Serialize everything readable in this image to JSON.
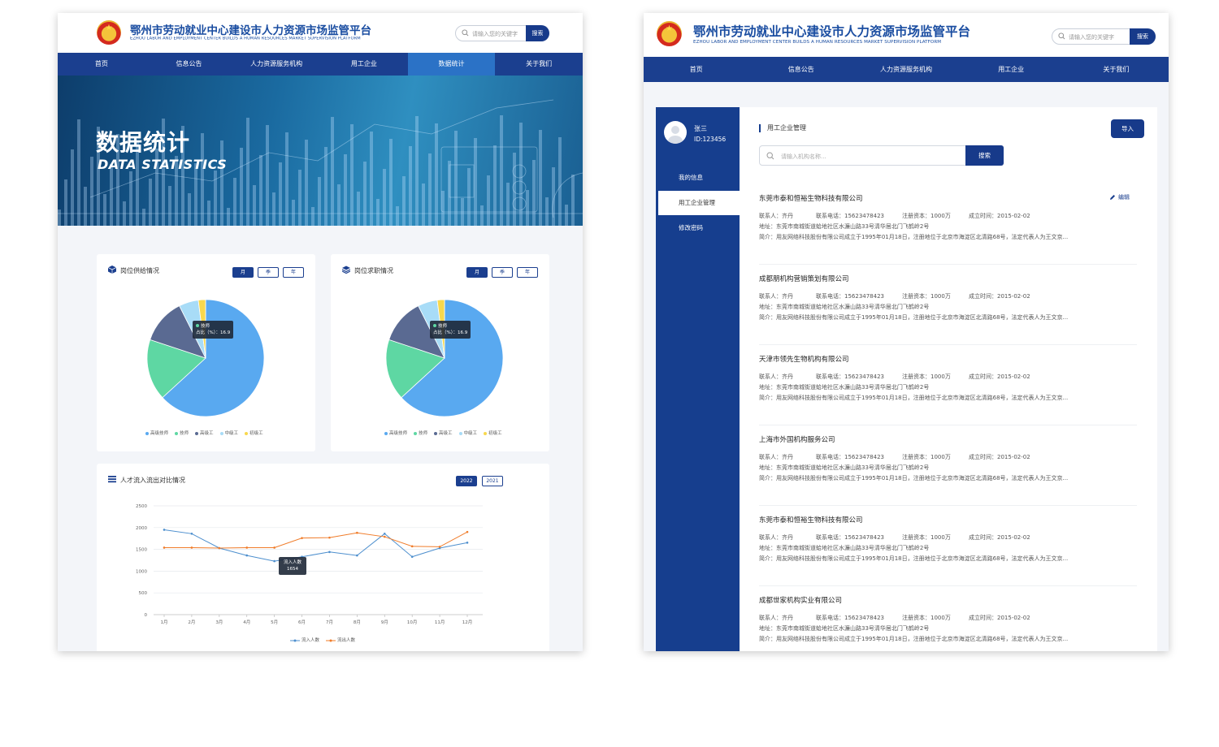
{
  "header": {
    "title_cn": "鄂州市劳动就业中心建设市人力资源市场监管平台",
    "title_en": "EZHOU LABOR AND EMPLOYMENT CENTER BUILDS A HUMAN RESOURCES MARKET SUPERVISION PLATFORM",
    "search_placeholder": "请输入您的关键字",
    "search_button": "搜索"
  },
  "nav_left": [
    "首页",
    "信息公告",
    "人力资源服务机构",
    "用工企业",
    "数据统计",
    "关于我们"
  ],
  "nav_left_active": "数据统计",
  "nav_right": [
    "首页",
    "信息公告",
    "人力资源服务机构",
    "用工企业",
    "关于我们"
  ],
  "banner": {
    "title_cn": "数据统计",
    "title_en": "DATA STATISTICS"
  },
  "pie_cards": [
    {
      "title": "岗位供给情况",
      "periods": [
        "月",
        "季",
        "年"
      ],
      "active_period": "月",
      "tooltip": {
        "label": "技师",
        "text": "占比（%）：16.9"
      }
    },
    {
      "title": "岗位求职情况",
      "periods": [
        "月",
        "季",
        "年"
      ],
      "active_period": "月",
      "tooltip": {
        "label": "技师",
        "text": "占比（%）：16.9"
      }
    }
  ],
  "line_card": {
    "title": "人才流入流出对比情况",
    "years": [
      "2022",
      "2021"
    ],
    "active_year": "2022",
    "tooltip": {
      "label": "流入人数",
      "value": "1654"
    }
  },
  "chart_data": [
    {
      "type": "pie",
      "title": "岗位供给情况",
      "categories": [
        "高级技师",
        "技师",
        "高级工",
        "中级工",
        "初级工"
      ],
      "values": [
        63.2,
        16.9,
        12.5,
        5.4,
        2.0
      ],
      "colors": [
        "#59a9f0",
        "#5ed7a3",
        "#5a6a92",
        "#a8dcf7",
        "#f8d84d"
      ],
      "legend": "bottom"
    },
    {
      "type": "pie",
      "title": "岗位求职情况",
      "categories": [
        "高级技师",
        "技师",
        "高级工",
        "中级工",
        "初级工"
      ],
      "values": [
        63.2,
        16.9,
        12.5,
        5.4,
        2.0
      ],
      "colors": [
        "#59a9f0",
        "#5ed7a3",
        "#5a6a92",
        "#a8dcf7",
        "#f8d84d"
      ],
      "legend": "bottom"
    },
    {
      "type": "line",
      "title": "人才流入流出对比情况",
      "x": [
        "1月",
        "2月",
        "3月",
        "4月",
        "5月",
        "6月",
        "7月",
        "8月",
        "9月",
        "10月",
        "11月",
        "12月"
      ],
      "ylim": [
        0,
        2500
      ],
      "yticks": [
        0,
        500,
        1000,
        1500,
        2000,
        2500
      ],
      "grid": true,
      "legend": "bottom",
      "series": [
        {
          "name": "流入人数",
          "color": "#4d8fce",
          "values": [
            1950,
            1860,
            1530,
            1360,
            1230,
            1330,
            1440,
            1360,
            1860,
            1330,
            1530,
            1654
          ]
        },
        {
          "name": "流出人数",
          "color": "#f07c2a",
          "values": [
            1540,
            1540,
            1530,
            1540,
            1540,
            1760,
            1770,
            1880,
            1790,
            1570,
            1560,
            1900
          ]
        }
      ]
    }
  ],
  "user": {
    "name": "张三",
    "id": "ID:123456"
  },
  "sidebar": [
    {
      "label": "我的信息",
      "active": false
    },
    {
      "label": "用工企业管理",
      "active": true
    },
    {
      "label": "修改密码",
      "active": false
    }
  ],
  "content": {
    "section_title": "用工企业管理",
    "import_button": "导入",
    "search_placeholder": "请输入机构名称...",
    "search_button": "搜索",
    "edit_label": "编辑",
    "orgs": [
      {
        "name": "东莞市泰和恒裕生物科技有限公司",
        "contact": "联系人：齐丹",
        "phone": "联系电话：15623478423",
        "capital": "注册资本：1000万",
        "founded": "成立时间：2015-02-02",
        "address": "地址：东莞市南城街道蛤地社区水濂山路33号清华居北门飞鹤岭2号",
        "intro": "简介：用友网络科技股份有限公司成立于1995年01月18日，注册地位于北京市海淀区北清路68号，法定代表人为王文京..."
      },
      {
        "name": "成都朋机构营销策划有限公司",
        "contact": "联系人：齐丹",
        "phone": "联系电话：15623478423",
        "capital": "注册资本：1000万",
        "founded": "成立时间：2015-02-02",
        "address": "地址：东莞市南城街道蛤地社区水濂山路33号清华居北门飞鹤岭2号",
        "intro": "简介：用友网络科技股份有限公司成立于1995年01月18日，注册地位于北京市海淀区北清路68号，法定代表人为王文京..."
      },
      {
        "name": "天津市领先生物机构有限公司",
        "contact": "联系人：齐丹",
        "phone": "联系电话：15623478423",
        "capital": "注册资本：1000万",
        "founded": "成立时间：2015-02-02",
        "address": "地址：东莞市南城街道蛤地社区水濂山路33号清华居北门飞鹤岭2号",
        "intro": "简介：用友网络科技股份有限公司成立于1995年01月18日，注册地位于北京市海淀区北清路68号，法定代表人为王文京..."
      },
      {
        "name": "上海市外国机构服务公司",
        "contact": "联系人：齐丹",
        "phone": "联系电话：15623478423",
        "capital": "注册资本：1000万",
        "founded": "成立时间：2015-02-02",
        "address": "地址：东莞市南城街道蛤地社区水濂山路33号清华居北门飞鹤岭2号",
        "intro": "简介：用友网络科技股份有限公司成立于1995年01月18日，注册地位于北京市海淀区北清路68号，法定代表人为王文京..."
      },
      {
        "name": "东莞市泰和恒裕生物科技有限公司",
        "contact": "联系人：齐丹",
        "phone": "联系电话：15623478423",
        "capital": "注册资本：1000万",
        "founded": "成立时间：2015-02-02",
        "address": "地址：东莞市南城街道蛤地社区水濂山路33号清华居北门飞鹤岭2号",
        "intro": "简介：用友网络科技股份有限公司成立于1995年01月18日，注册地位于北京市海淀区北清路68号，法定代表人为王文京..."
      },
      {
        "name": "成都世家机构实业有限公司",
        "contact": "联系人：齐丹",
        "phone": "联系电话：15623478423",
        "capital": "注册资本：1000万",
        "founded": "成立时间：2015-02-02",
        "address": "地址：东莞市南城街道蛤地社区水濂山路33号清华居北门飞鹤岭2号",
        "intro": "简介：用友网络科技股份有限公司成立于1995年01月18日，注册地位于北京市海淀区北清路68号，法定代表人为王文京..."
      }
    ]
  }
}
